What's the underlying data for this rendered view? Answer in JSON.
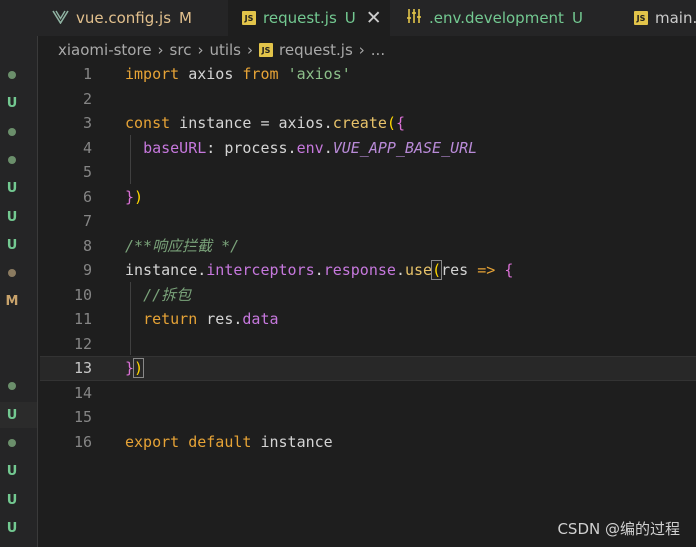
{
  "tabs": [
    {
      "label": "vue.config.js",
      "status": "M",
      "icon": "vue-file-icon"
    },
    {
      "label": "request.js",
      "status": "U",
      "icon": "js-file-icon",
      "active": true,
      "close": "✕"
    },
    {
      "label": ".env.development",
      "status": "U",
      "icon": "env-file-icon"
    },
    {
      "label": "main.js",
      "status": "",
      "icon": "js-file-icon"
    }
  ],
  "breadcrumb": [
    "xiaomi-store",
    "src",
    "utils",
    "request.js",
    "..."
  ],
  "js_icon_text": "JS",
  "scm_gutter": [
    {
      "type": "dot",
      "color": "#6b8f6b"
    },
    {
      "type": "U",
      "color": "#73c991"
    },
    {
      "type": "dot",
      "color": "#6b8f6b"
    },
    {
      "type": "dot",
      "color": "#6b8f6b"
    },
    {
      "type": "U",
      "color": "#73c991"
    },
    {
      "type": "U",
      "color": "#73c991"
    },
    {
      "type": "U",
      "color": "#73c991"
    },
    {
      "type": "dot",
      "color": "#8b7b60"
    },
    {
      "type": "M",
      "color": "#c9a36b"
    },
    {
      "type": "blank"
    },
    {
      "type": "blank"
    },
    {
      "type": "dot",
      "color": "#6b8f6b"
    },
    {
      "type": "U",
      "color": "#73c991"
    },
    {
      "type": "dot",
      "color": "#6b8f6b"
    },
    {
      "type": "U",
      "color": "#73c991"
    },
    {
      "type": "U",
      "color": "#73c991"
    },
    {
      "type": "U",
      "color": "#73c991"
    }
  ],
  "lines": [
    {
      "n": "1",
      "tokens": [
        [
          "kw",
          "import"
        ],
        [
          "id",
          " axios "
        ],
        [
          "kw",
          "from"
        ],
        [
          "id",
          " "
        ],
        [
          "str",
          "'axios'"
        ]
      ]
    },
    {
      "n": "2",
      "tokens": []
    },
    {
      "n": "3",
      "tokens": [
        [
          "kw",
          "const"
        ],
        [
          "id",
          " instance = axios."
        ],
        [
          "fn",
          "create"
        ],
        [
          "br1",
          "("
        ],
        [
          "br2",
          "{"
        ]
      ]
    },
    {
      "n": "4",
      "tokens": [
        [
          "id",
          "  "
        ],
        [
          "prop",
          "baseURL"
        ],
        [
          "id",
          ": process."
        ],
        [
          "obj",
          "env"
        ],
        [
          "id",
          "."
        ],
        [
          "it",
          "VUE_APP_BASE_URL"
        ]
      ]
    },
    {
      "n": "5",
      "tokens": []
    },
    {
      "n": "6",
      "tokens": [
        [
          "br2",
          "}"
        ],
        [
          "br1",
          ")"
        ]
      ]
    },
    {
      "n": "7",
      "tokens": []
    },
    {
      "n": "8",
      "tokens": [
        [
          "cmt",
          "/**响应拦截 */"
        ]
      ]
    },
    {
      "n": "9",
      "tokens": [
        [
          "id",
          "instance."
        ],
        [
          "prop",
          "interceptors"
        ],
        [
          "id",
          "."
        ],
        [
          "prop",
          "response"
        ],
        [
          "id",
          "."
        ],
        [
          "fn",
          "use"
        ],
        [
          "br1b",
          "("
        ],
        [
          "id",
          "res "
        ],
        [
          "kw",
          "=>"
        ],
        [
          "id",
          " "
        ],
        [
          "br2",
          "{"
        ]
      ]
    },
    {
      "n": "10",
      "tokens": [
        [
          "id",
          "  "
        ],
        [
          "cmt",
          "//拆包"
        ]
      ]
    },
    {
      "n": "11",
      "tokens": [
        [
          "id",
          "  "
        ],
        [
          "kw",
          "return"
        ],
        [
          "id",
          " res."
        ],
        [
          "prop",
          "data"
        ]
      ]
    },
    {
      "n": "12",
      "tokens": []
    },
    {
      "n": "13",
      "tokens": [
        [
          "br2",
          "}"
        ],
        [
          "br1b",
          ")"
        ]
      ],
      "current": true
    },
    {
      "n": "14",
      "tokens": []
    },
    {
      "n": "15",
      "tokens": []
    },
    {
      "n": "16",
      "tokens": [
        [
          "kw",
          "export"
        ],
        [
          "id",
          " "
        ],
        [
          "kw",
          "default"
        ],
        [
          "id",
          " instance"
        ]
      ]
    }
  ],
  "watermark": "CSDN @编的过程",
  "colors": {
    "tab_modified": "#e2c08d",
    "tab_untracked": "#73c991",
    "editor_bg": "#1e1e1e",
    "sidebar_bg": "#252526"
  }
}
